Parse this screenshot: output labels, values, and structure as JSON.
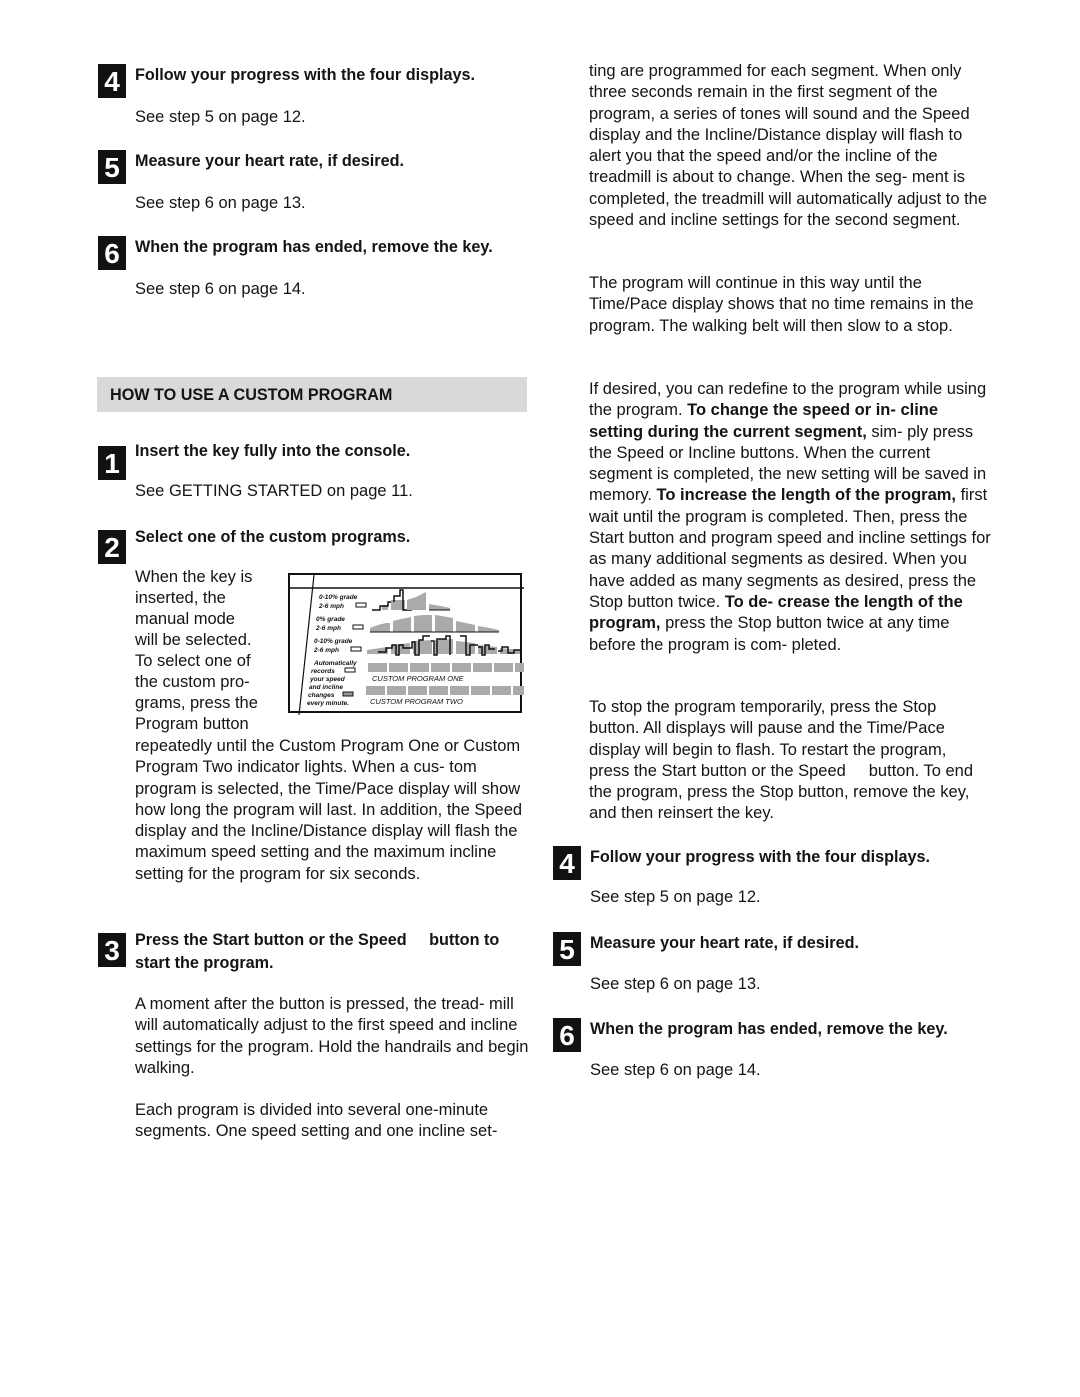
{
  "left_column": {
    "steps_top": [
      {
        "number": "4",
        "title": "Follow your progress with the four displays.",
        "sub": "See step 5 on page 12."
      },
      {
        "number": "5",
        "title": "Measure your heart rate, if desired.",
        "sub": "See step 6 on page 13."
      },
      {
        "number": "6",
        "title": "When the program has ended, remove the key.",
        "sub": "See step 6 on page 14."
      }
    ],
    "section_heading": "HOW TO USE A CUSTOM PROGRAM",
    "step1": {
      "number": "1",
      "title": "Insert the key fully into the console.",
      "sub": "See GETTING STARTED on page 11."
    },
    "step2": {
      "number": "2",
      "title": "Select one of the custom programs.",
      "wrap_lines": [
        "When the key is",
        "inserted, the",
        "manual mode",
        "will be selected.",
        "To select one of",
        "the custom pro-",
        "grams, press the",
        "Program button"
      ],
      "body": "repeatedly until the Custom Program One or Custom Program Two indicator lights. When a cus- tom program is selected, the Time/Pace display will show how long the program will last. In addition, the Speed display and the Incline/Distance display will flash the maximum speed setting and the maximum incline setting for the program for six seconds."
    },
    "step3": {
      "number": "3",
      "title_line1": "Press the Start button or the Speed     button to",
      "title_line2": "start the program.",
      "para1": "A moment after the button is pressed, the tread- mill will automatically adjust to the first speed and incline settings for the program. Hold the handrails and begin walking.",
      "para2": "Each program is divided into several one-minute segments. One speed setting and one incline set-"
    }
  },
  "console_figure": {
    "rows": [
      {
        "label1": "0-10% grade",
        "label2": "2-6 mph"
      },
      {
        "label1": "0% grade",
        "label2": "2-6 mph"
      },
      {
        "label1": "0-10% grade",
        "label2": "2-6 mph"
      }
    ],
    "auto_text": [
      "Automatically",
      "records",
      "your speed",
      "and incline",
      "changes",
      "every minute."
    ],
    "program_one": "CUSTOM PROGRAM ONE",
    "program_two": "CUSTOM PROGRAM TWO"
  },
  "right_column": {
    "para1": "ting are programmed for each segment. When only three seconds remain in the first segment of the program, a series of tones will sound and the Speed display and the Incline/Distance display will flash to alert you that the speed and/or the incline of the treadmill is about to change. When the seg- ment is completed, the treadmill will automatically adjust to the speed and incline settings for the second segment.",
    "para2": "The program will continue in this way until the Time/Pace display shows that no time remains in the program. The walking belt will then slow to a stop.",
    "para3": {
      "t1": "If desired, you can redefine to the program while using the program. ",
      "b1": "To change the speed or in- cline setting during the current segment,",
      "t2": " sim- ply press the Speed or Incline buttons. When the current segment is completed, the new setting will be saved in memory. ",
      "b2": "To increase the length of the program,",
      "t3": " first wait until the program is completed. Then, press the Start button and program speed and incline settings for as many additional segments as desired. When you have added as many segments as desired, press the Stop button twice. ",
      "b3": "To de- crease the length of the program,",
      "t4": " press the Stop button twice at any time before the program is com- pleted."
    },
    "para4": "To stop the program temporarily, press the Stop button. All displays will pause and the Time/Pace display will begin to flash. To restart the program, press the Start button or the Speed     button. To end the program, press the Stop button, remove the key, and then reinsert the key.",
    "steps": [
      {
        "number": "4",
        "title": "Follow your progress with the four displays.",
        "sub": "See step 5 on page 12."
      },
      {
        "number": "5",
        "title": "Measure your heart rate, if desired.",
        "sub": "See step 6 on page 13."
      },
      {
        "number": "6",
        "title": "When the program has ended, remove the key.",
        "sub": "See step 6 on page 14."
      }
    ]
  }
}
